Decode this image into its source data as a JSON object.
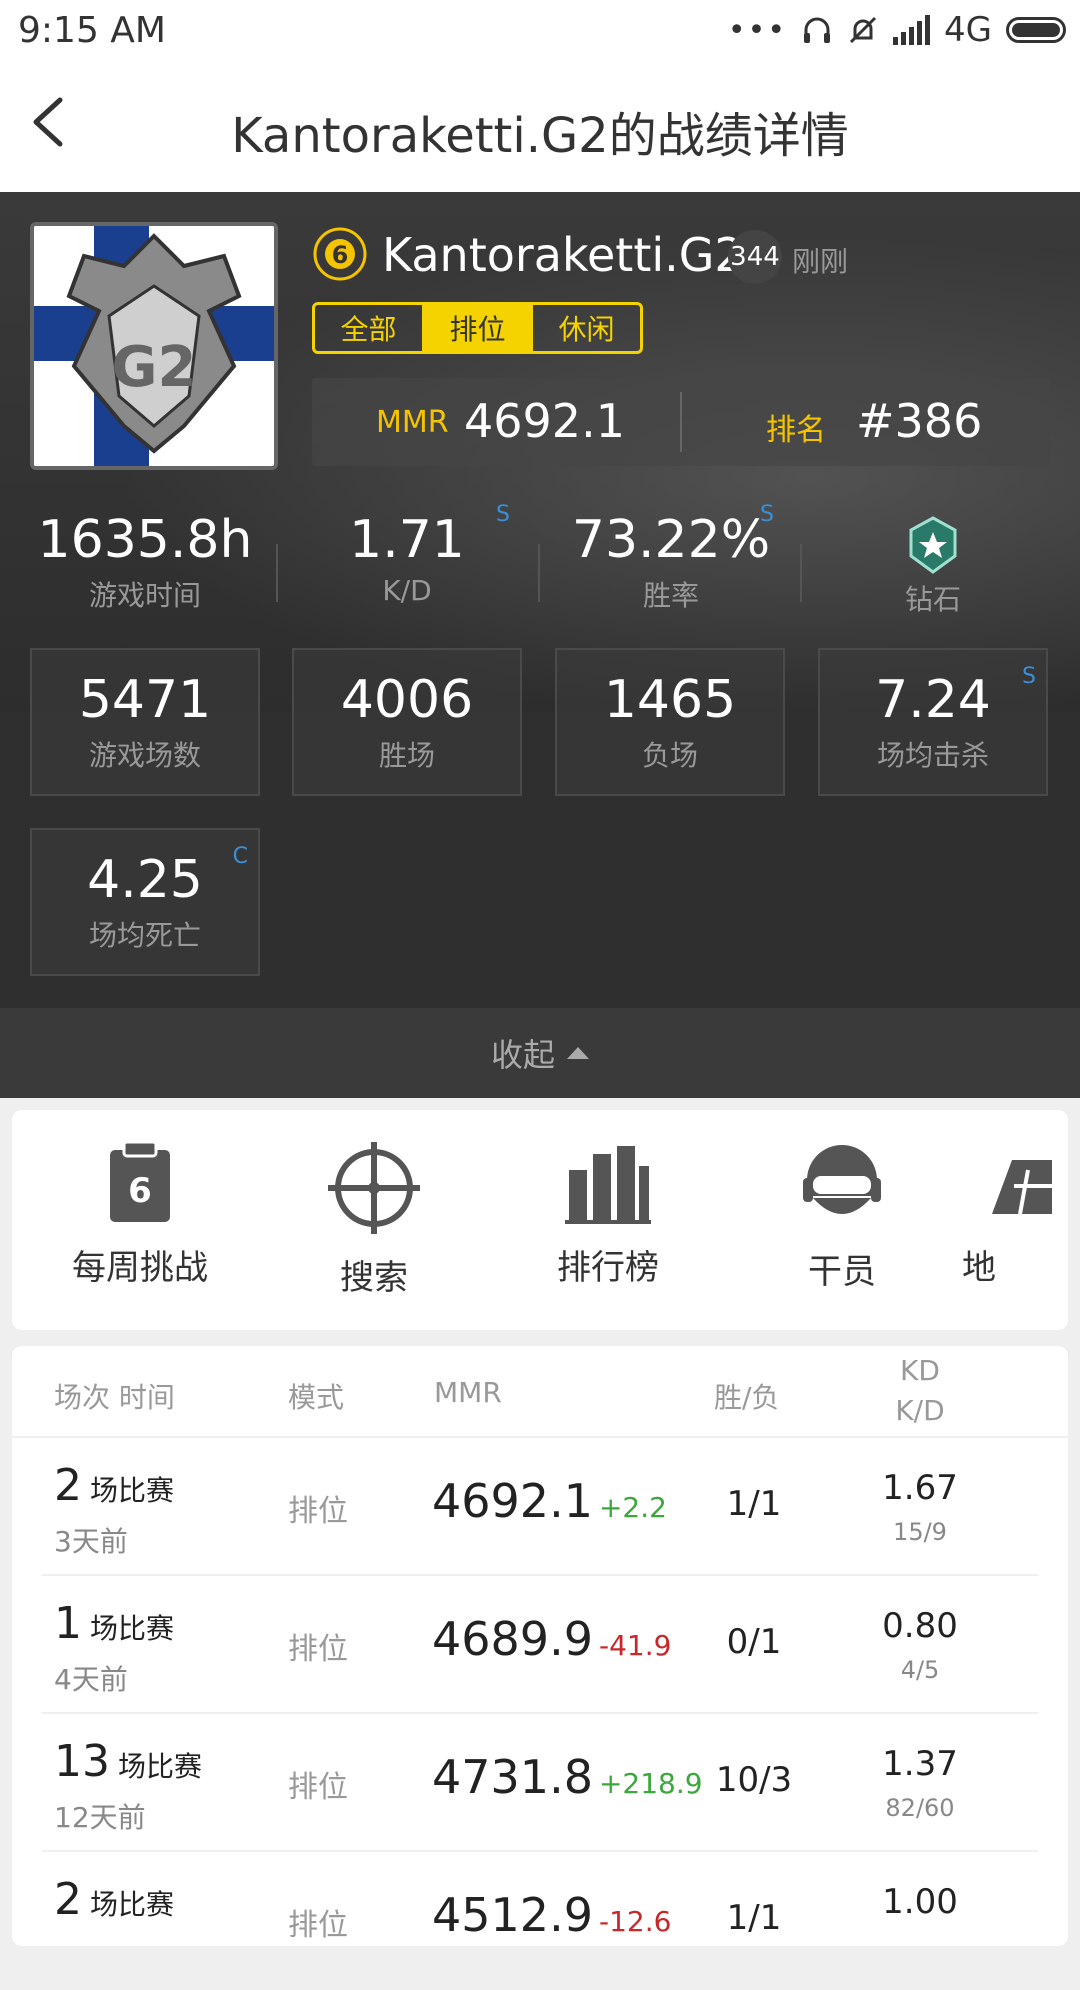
{
  "status_bar": {
    "time": "9:15  AM",
    "network": "4G"
  },
  "header": {
    "title": "Kantoraketti.G2的战绩详情"
  },
  "player": {
    "name": "Kantoraketti.G2",
    "level": "344",
    "updated": "刚刚",
    "tabs": [
      "全部",
      "排位",
      "休闲"
    ],
    "active_tab": "排位",
    "mmr_label": "MMR",
    "mmr_value": "4692.1",
    "rank_label": "排名",
    "rank_value": "#386"
  },
  "summary": [
    {
      "value": "1635.8h",
      "label": "游戏时间",
      "sup": ""
    },
    {
      "value": "1.71",
      "label": "K/D",
      "sup": "S"
    },
    {
      "value": "73.22%",
      "label": "胜率",
      "sup": "S"
    },
    {
      "value": "",
      "label": "钻石",
      "sup": ""
    }
  ],
  "boxes": [
    {
      "value": "5471",
      "label": "游戏场数",
      "sup": ""
    },
    {
      "value": "4006",
      "label": "胜场",
      "sup": ""
    },
    {
      "value": "1465",
      "label": "负场",
      "sup": ""
    },
    {
      "value": "7.24",
      "label": "场均击杀",
      "sup": "S"
    },
    {
      "value": "4.25",
      "label": "场均死亡",
      "sup": "C"
    }
  ],
  "collapse_label": "收起",
  "quick_nav": [
    {
      "label": "每周挑战",
      "icon": "challenge-icon"
    },
    {
      "label": "搜索",
      "icon": "crosshair-icon"
    },
    {
      "label": "排行榜",
      "icon": "leaderboard-icon"
    },
    {
      "label": "干员",
      "icon": "operator-icon"
    },
    {
      "label": "地",
      "icon": "map-icon"
    }
  ],
  "table": {
    "headers": {
      "session": "场次 时间",
      "mode": "模式",
      "mmr": "MMR",
      "wl": "胜/负",
      "kd1": "KD",
      "kd2": "K/D"
    },
    "rows": [
      {
        "count": "2",
        "unit": "场比赛",
        "ago": "3天前",
        "mode": "排位",
        "mmr": "4692.1",
        "delta": "+2.2",
        "trend": "up",
        "wl": "1/1",
        "kd": "1.67",
        "kills_deaths": "15/9"
      },
      {
        "count": "1",
        "unit": "场比赛",
        "ago": "4天前",
        "mode": "排位",
        "mmr": "4689.9",
        "delta": "-41.9",
        "trend": "down",
        "wl": "0/1",
        "kd": "0.80",
        "kills_deaths": "4/5"
      },
      {
        "count": "13",
        "unit": "场比赛",
        "ago": "12天前",
        "mode": "排位",
        "mmr": "4731.8",
        "delta": "+218.9",
        "trend": "up",
        "wl": "10/3",
        "kd": "1.37",
        "kills_deaths": "82/60"
      },
      {
        "count": "2",
        "unit": "场比赛",
        "ago": "",
        "mode": "排位",
        "mmr": "4512.9",
        "delta": "-12.6",
        "trend": "down",
        "wl": "1/1",
        "kd": "1.00",
        "kills_deaths": ""
      }
    ]
  }
}
